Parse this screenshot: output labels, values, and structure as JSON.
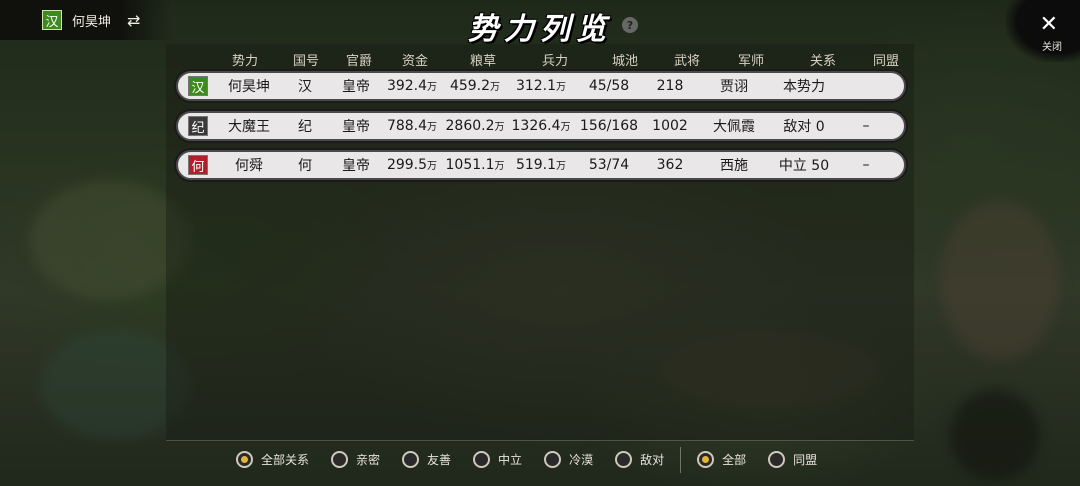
{
  "player": {
    "flag": "汉",
    "name": "何昊坤",
    "flag_color": "#3e8a1e"
  },
  "title": "势力列览",
  "help_label": "?",
  "close_label": "关闭",
  "table": {
    "headers": [
      "势力",
      "国号",
      "官爵",
      "资金",
      "粮草",
      "兵力",
      "城池",
      "武将",
      "军师",
      "关系",
      "同盟"
    ],
    "rows": [
      {
        "flag": "汉",
        "flag_color": "#3e8a1e",
        "name": "何昊坤",
        "nation": "汉",
        "rank": "皇帝",
        "gold": "392.4",
        "gold_unit": "万",
        "food": "459.2",
        "food_unit": "万",
        "troops": "312.1",
        "troops_unit": "万",
        "cities": "45/58",
        "generals": "218",
        "advisor": "贾诩",
        "relation": "本势力",
        "alliance": ""
      },
      {
        "flag": "纪",
        "flag_color": "#3a3a3a",
        "name": "大魔王",
        "nation": "纪",
        "rank": "皇帝",
        "gold": "788.4",
        "gold_unit": "万",
        "food": "2860.2",
        "food_unit": "万",
        "troops": "1326.4",
        "troops_unit": "万",
        "cities": "156/168",
        "generals": "1002",
        "advisor": "大佩霞",
        "relation": "敌对 0",
        "alliance": "–"
      },
      {
        "flag": "何",
        "flag_color": "#b0202a",
        "name": "何舜",
        "nation": "何",
        "rank": "皇帝",
        "gold": "299.5",
        "gold_unit": "万",
        "food": "1051.1",
        "food_unit": "万",
        "troops": "519.1",
        "troops_unit": "万",
        "cities": "53/74",
        "generals": "362",
        "advisor": "西施",
        "relation": "中立 50",
        "alliance": "–"
      }
    ]
  },
  "filters": {
    "relations": [
      {
        "label": "全部关系",
        "selected": true
      },
      {
        "label": "亲密",
        "selected": false
      },
      {
        "label": "友善",
        "selected": false
      },
      {
        "label": "中立",
        "selected": false
      },
      {
        "label": "冷漠",
        "selected": false
      },
      {
        "label": "敌对",
        "selected": false
      }
    ],
    "alliance": [
      {
        "label": "全部",
        "selected": true
      },
      {
        "label": "同盟",
        "selected": false
      }
    ]
  },
  "colors": {
    "accent_gold": "#e4b43a",
    "row_bg": "#e9e7e7"
  }
}
